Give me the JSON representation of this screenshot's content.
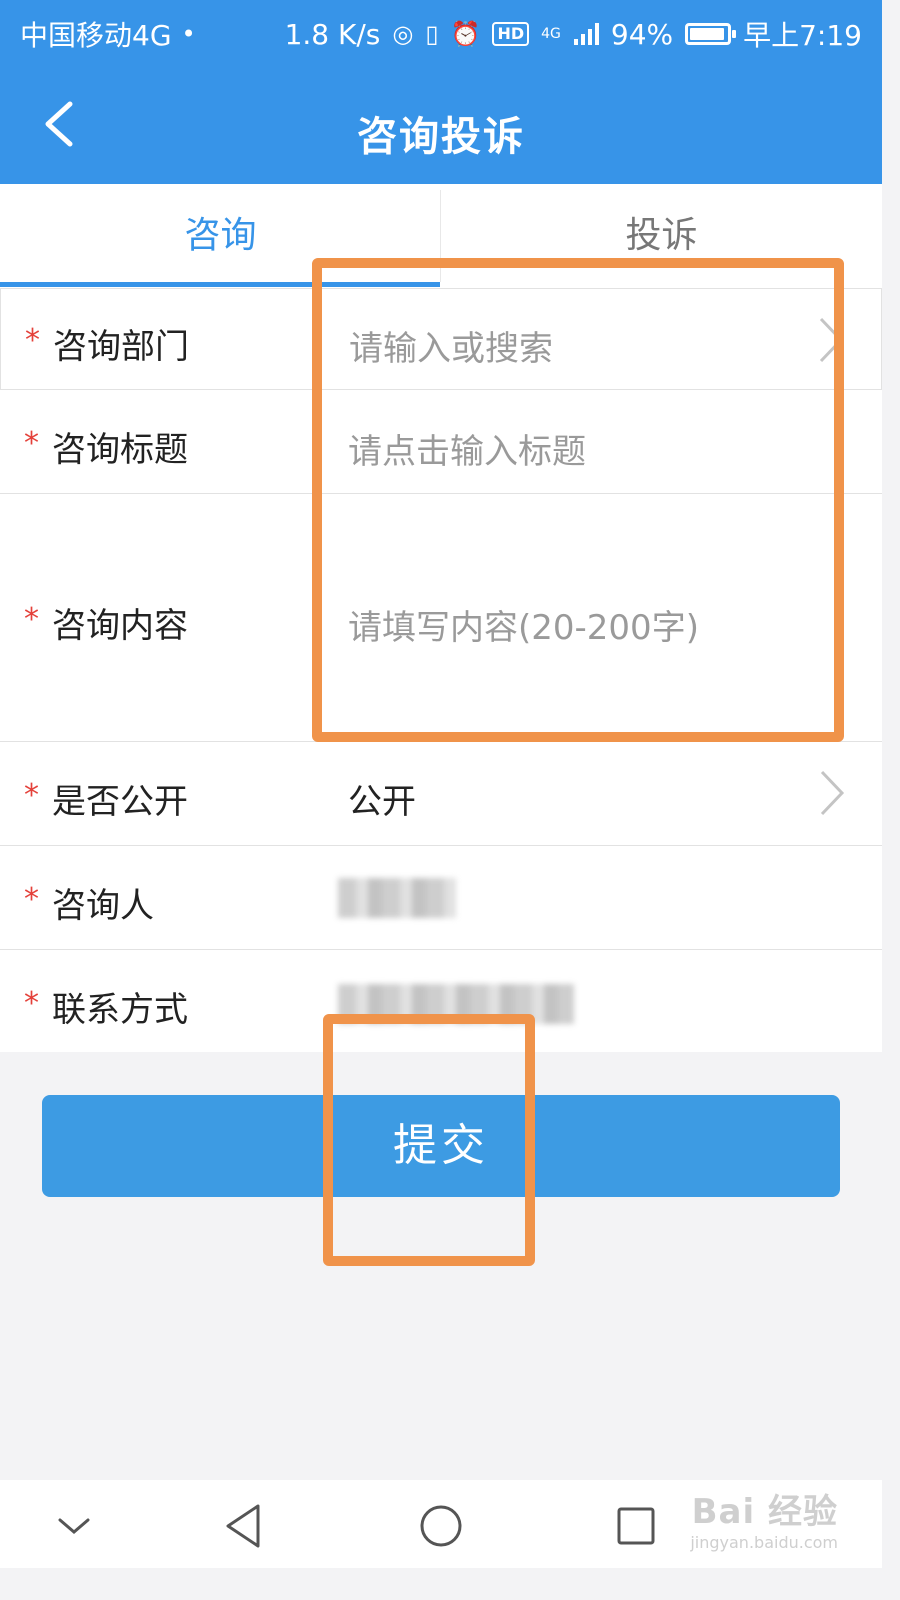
{
  "statusbar": {
    "carrier": "中国移动4G",
    "speed": "1.8 K/s",
    "hd_label": "HD",
    "network": "4G",
    "battery": "94%",
    "battery_level": 0.94,
    "time": "早上7:19"
  },
  "appbar": {
    "title": "咨询投诉",
    "back_icon": "chevron-left-icon"
  },
  "tabs": [
    {
      "label": "咨询",
      "active": true
    },
    {
      "label": "投诉",
      "active": false
    }
  ],
  "form": {
    "required_mark": "*",
    "fields": [
      {
        "label": "咨询部门",
        "placeholder": "请输入或搜索"
      },
      {
        "label": "咨询标题",
        "placeholder": "请点击输入标题"
      },
      {
        "label": "咨询内容",
        "placeholder": "请填写内容(20-200字)"
      },
      {
        "label": "是否公开",
        "value": "公开"
      },
      {
        "label": "咨询人"
      },
      {
        "label": "联系方式"
      }
    ]
  },
  "submit": {
    "label": "提交"
  },
  "navbar": {
    "icons": [
      "chevron-down-icon",
      "back-triangle-icon",
      "home-circle-icon",
      "recents-square-icon"
    ]
  },
  "watermark": {
    "main": "Bai 经验",
    "sub": "jingyan.baidu.com"
  },
  "colors": {
    "primary": "#3794e8",
    "button": "#3d9be3",
    "required": "#e4413a",
    "highlight": "#f0934a",
    "placeholder": "#9a9a9a"
  }
}
